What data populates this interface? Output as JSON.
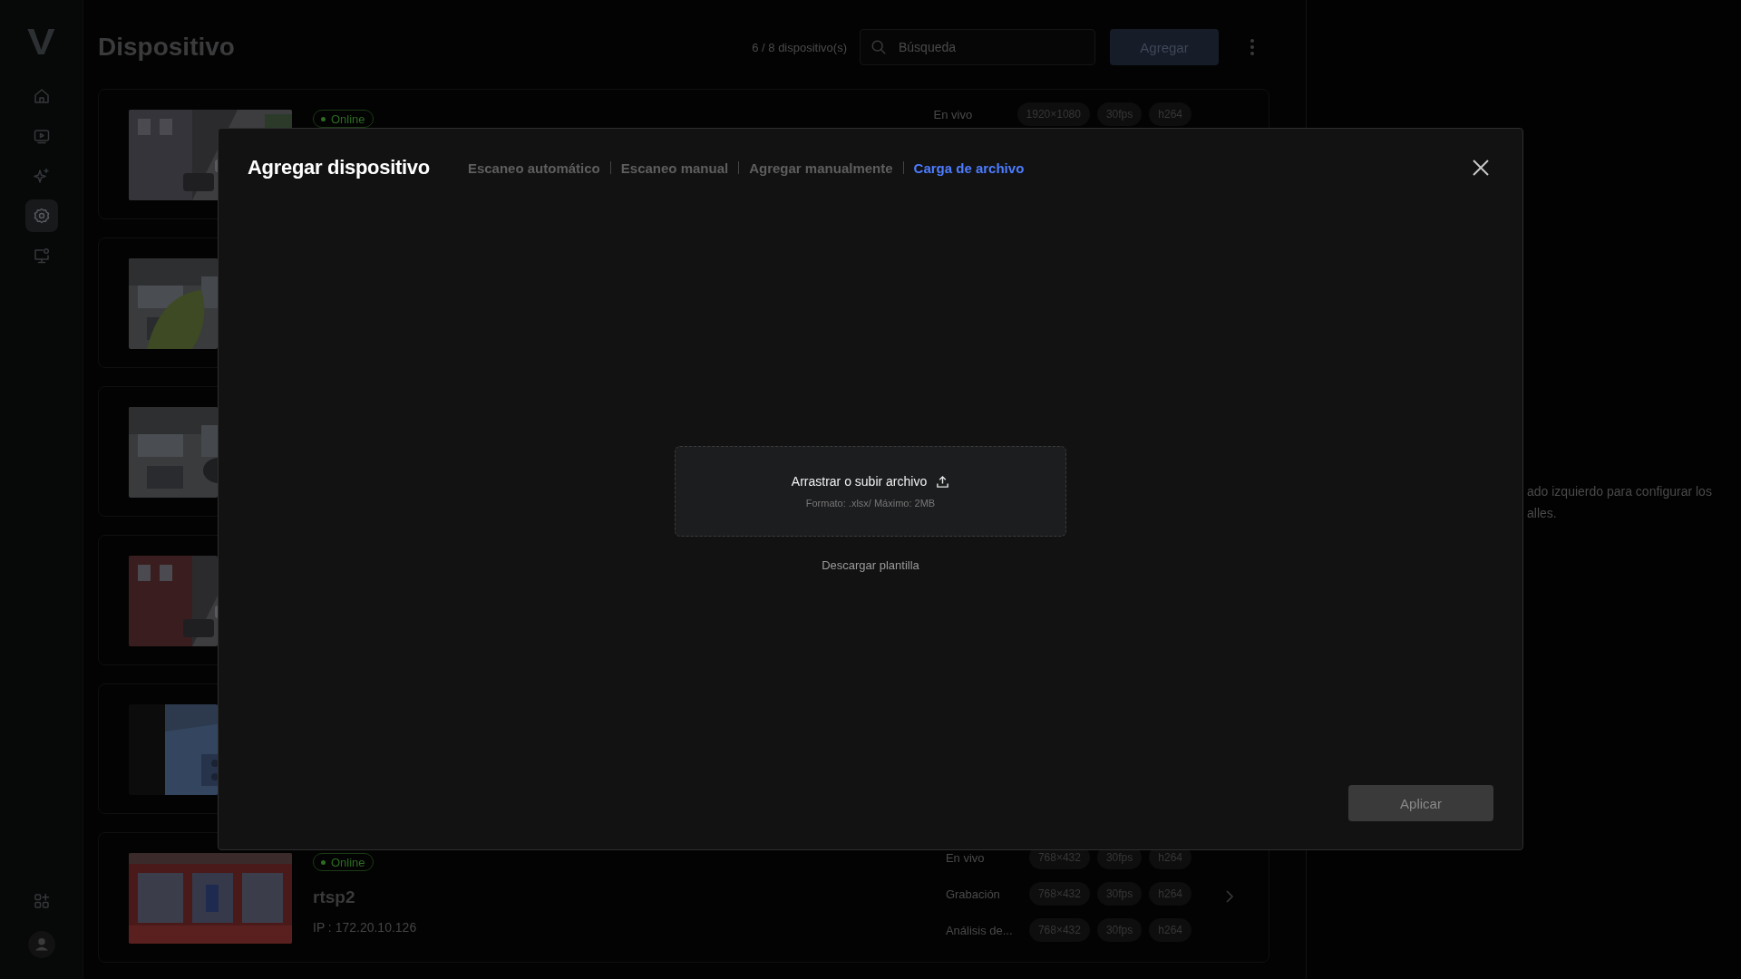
{
  "sidebar": {
    "logo": "V",
    "nav_items": [
      {
        "selected": false
      },
      {
        "selected": false
      },
      {
        "selected": false
      },
      {
        "selected": true
      },
      {
        "selected": false
      }
    ],
    "bottom_items": [
      {
        "selected": false
      },
      {
        "selected": false
      }
    ]
  },
  "header": {
    "title": "Dispositivo",
    "device_count": "6 / 8 dispositivo(s)",
    "search": {
      "placeholder": "Búsqueda"
    },
    "add_button": "Agregar"
  },
  "devices": [
    {
      "kind": "picture",
      "status": "Online",
      "streams": [
        {
          "label": "En vivo",
          "resolution": "1920×1080",
          "fps": "30fps",
          "codec": "h264"
        }
      ]
    },
    {
      "kind": "picture"
    },
    {
      "kind": "picture"
    },
    {
      "kind": "picture"
    },
    {
      "kind": "picture"
    },
    {
      "kind": "picture",
      "status": "Online",
      "name": "rtsp2",
      "ip": "IP : 172.20.10.126",
      "has_details": true,
      "streams": [
        {
          "label": "En vivo",
          "resolution": "768×432",
          "fps": "30fps",
          "codec": "h264"
        },
        {
          "label": "Grabación",
          "resolution": "768×432",
          "fps": "30fps",
          "codec": "h264"
        },
        {
          "label": "Análisis de...",
          "resolution": "768×432",
          "fps": "30fps",
          "codec": "h264"
        }
      ]
    }
  ],
  "detail_panel": {
    "hint_lines": [
      "ado izquierdo para configurar los",
      "alles."
    ]
  },
  "modal": {
    "title": "Agregar dispositivo",
    "tabs": [
      {
        "label": "Escaneo automático",
        "selected": false
      },
      {
        "label": "Escaneo manual",
        "selected": false
      },
      {
        "label": "Agregar manualmente",
        "selected": false
      },
      {
        "label": "Carga de archivo",
        "selected": true
      }
    ],
    "upload": {
      "label": "Arrastrar o subir archivo",
      "hint": "Formato: .xlsx/ Máximo: 2MB"
    },
    "template_link": "Descargar plantilla",
    "apply_button": {
      "label": "Aplicar",
      "disabled": true
    }
  }
}
